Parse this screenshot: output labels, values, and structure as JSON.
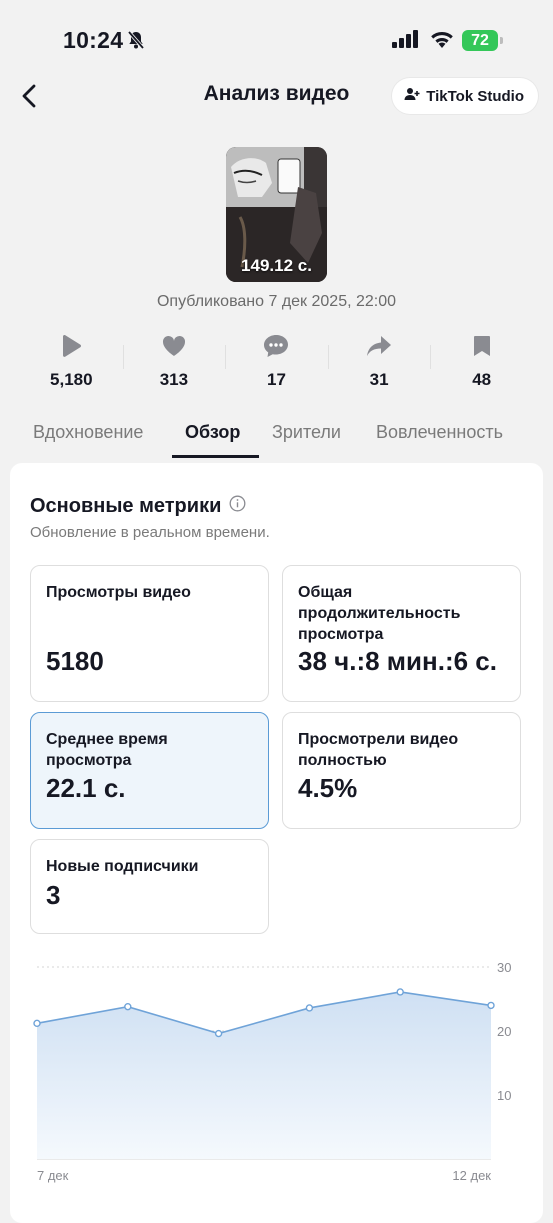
{
  "status_bar": {
    "time": "10:24",
    "battery": "72"
  },
  "nav": {
    "title": "Анализ видео",
    "studio_button": "TikTok Studio"
  },
  "video": {
    "duration": "149.12 с.",
    "published": "Опубликовано 7 дек 2025, 22:00"
  },
  "stats": [
    {
      "icon": "play-icon",
      "value": "5,180"
    },
    {
      "icon": "heart-icon",
      "value": "313"
    },
    {
      "icon": "comment-icon",
      "value": "17"
    },
    {
      "icon": "share-icon",
      "value": "31"
    },
    {
      "icon": "bookmark-icon",
      "value": "48"
    }
  ],
  "tabs": [
    {
      "label": "Вдохновение",
      "active": false
    },
    {
      "label": "Обзор",
      "active": true
    },
    {
      "label": "Зрители",
      "active": false
    },
    {
      "label": "Вовлеченность",
      "active": false
    }
  ],
  "metrics_section": {
    "title": "Основные метрики",
    "subtitle": "Обновление в реальном времени.",
    "cards": [
      {
        "label": "Просмотры видео",
        "value": "5180"
      },
      {
        "label": "Общая продолжительность просмотра",
        "value": "38 ч.:8 мин.:6 с."
      },
      {
        "label": "Среднее время просмотра",
        "value": "22.1 с.",
        "selected": true
      },
      {
        "label": "Просмотрели видео полностью",
        "value": "4.5%"
      },
      {
        "label": "Новые подписчики",
        "value": "3"
      }
    ]
  },
  "chart_data": {
    "type": "area",
    "x": [
      "7 дек",
      "8 дек",
      "9 дек",
      "10 дек",
      "11 дек",
      "12 дек"
    ],
    "x_tick_labels": [
      "7 дек",
      "12 дек"
    ],
    "series": [
      {
        "values": [
          21.2,
          23.8,
          19.6,
          23.6,
          26.1,
          24.0
        ]
      }
    ],
    "y_ticks": [
      10,
      20,
      30
    ],
    "ylim": [
      0,
      30
    ],
    "grid": true,
    "color": "#6fa3d8"
  }
}
